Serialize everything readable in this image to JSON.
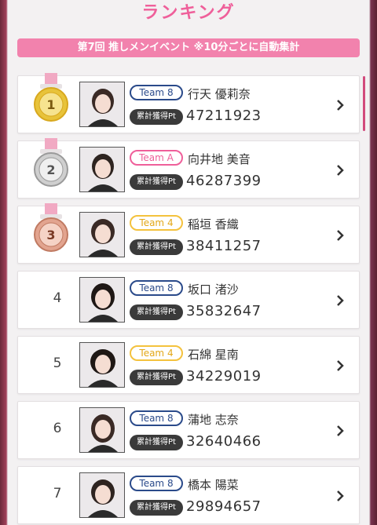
{
  "header": {
    "title": "ランキング"
  },
  "banner": {
    "text": "第7回 推しメンイベント ※10分ごとに自動集計"
  },
  "points_label": "累計獲得Pt",
  "rows": [
    {
      "rank": "1",
      "medal": "gold",
      "team": "Team 8",
      "team_color": "#2a4a8a",
      "name": "行天 優莉奈",
      "points": "47211923"
    },
    {
      "rank": "2",
      "medal": "silver",
      "team": "Team A",
      "team_color": "#ef5f9a",
      "name": "向井地 美音",
      "points": "46287399"
    },
    {
      "rank": "3",
      "medal": "bronze",
      "team": "Team 4",
      "team_color": "#f4c23d",
      "name": "稲垣 香織",
      "points": "38411257"
    },
    {
      "rank": "4",
      "team": "Team 8",
      "team_color": "#2a4a8a",
      "name": "坂口 渚沙",
      "points": "35832647"
    },
    {
      "rank": "5",
      "team": "Team 4",
      "team_color": "#f4c23d",
      "name": "石綿 星南",
      "points": "34229019"
    },
    {
      "rank": "6",
      "team": "Team 8",
      "team_color": "#2a4a8a",
      "name": "蒲地 志奈",
      "points": "32640466"
    },
    {
      "rank": "7",
      "team": "Team 8",
      "team_color": "#2a4a8a",
      "name": "橋本 陽菜",
      "points": "29894657"
    }
  ],
  "colors": {
    "accent": "#ef5f9a",
    "banner": "#f282ad",
    "gold": "#e8c33a",
    "silver": "#bfbfbf",
    "bronze": "#e2a48f"
  }
}
